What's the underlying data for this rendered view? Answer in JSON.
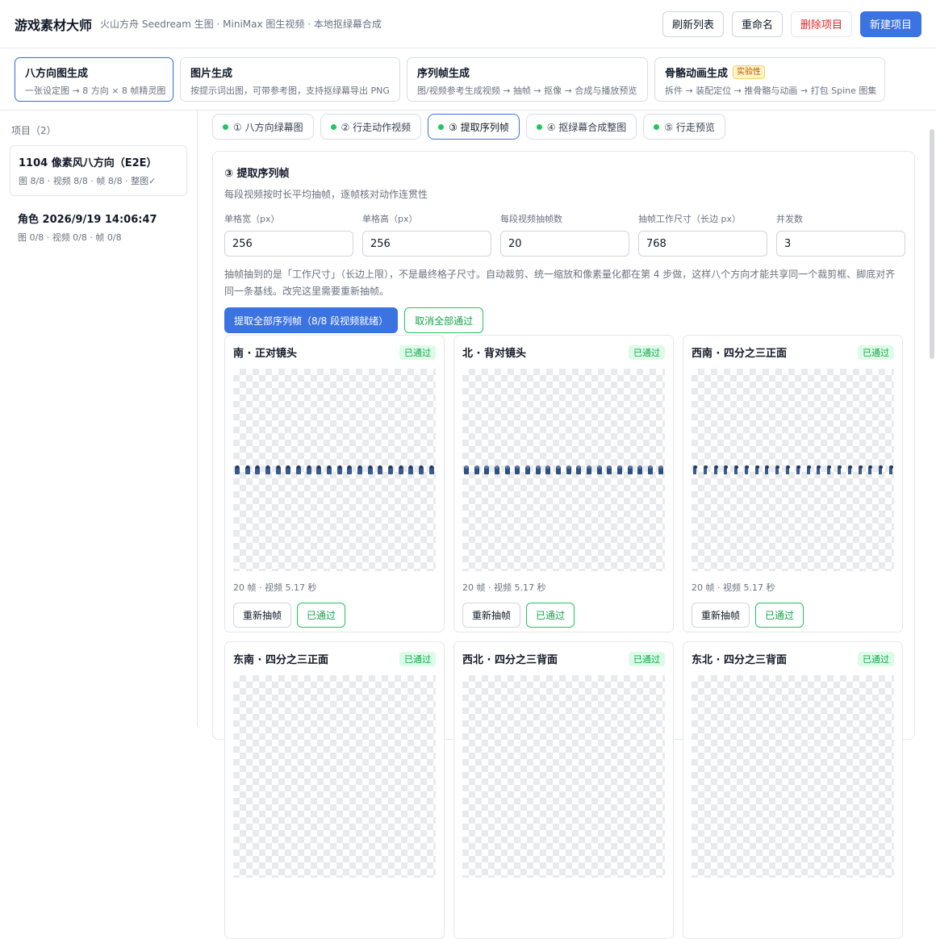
{
  "header": {
    "title": "游戏素材大师",
    "subtitle": "火山方舟 Seedream 生图 · MiniMax 图生视频 · 本地抠绿幕合成",
    "buttons": {
      "refresh": "刷新列表",
      "rename": "重命名",
      "delete": "删除项目",
      "new": "新建项目"
    }
  },
  "modes": [
    {
      "title": "八方向图生成",
      "desc": "一张设定图 → 8 方向 × 8 帧精灵图"
    },
    {
      "title": "图片生成",
      "desc": "按提示词出图，可带参考图，支持抠绿幕导出 PNG"
    },
    {
      "title": "序列帧生成",
      "desc": "图/视频参考生成视频 → 抽帧 → 抠像 → 合成与播放预览"
    },
    {
      "title": "骨骼动画生成",
      "badge": "实验性",
      "desc": "拆件 → 装配定位 → 推骨骼与动画 → 打包 Spine 图集"
    }
  ],
  "sidebar": {
    "heading": "项目（2）",
    "projects": [
      {
        "name": "1104 像素风八方向（E2E）",
        "meta": "图 8/8 · 视频 8/8 · 帧 8/8 · 整图✓"
      },
      {
        "name": "角色 2026/9/19 14:06:47",
        "meta": "图 0/8 · 视频 0/8 · 帧 0/8"
      }
    ]
  },
  "steps": [
    {
      "label": "① 八方向绿幕图"
    },
    {
      "label": "② 行走动作视频"
    },
    {
      "label": "③ 提取序列帧"
    },
    {
      "label": "④ 抠绿幕合成整图"
    },
    {
      "label": "⑤ 行走预览"
    }
  ],
  "panel": {
    "title": "③ 提取序列帧",
    "desc": "每段视频按时长平均抽帧，逐帧核对动作连贯性",
    "fields": [
      {
        "label": "单格宽（px）",
        "value": "256"
      },
      {
        "label": "单格高（px）",
        "value": "256"
      },
      {
        "label": "每段视频抽帧数",
        "value": "20"
      },
      {
        "label": "抽帧工作尺寸（长边 px）",
        "value": "768"
      },
      {
        "label": "并发数",
        "value": "3"
      }
    ],
    "note": "抽帧抽到的是「工作尺寸」（长边上限），不是最终格子尺寸。自动裁剪、统一缩放和像素量化都在第 4 步做，这样八个方向才能共享同一个裁剪框、脚底对齐同一条基线。改完这里需要重新抽帧。",
    "extract_all": "提取全部序列帧（8/8 段视频就绪）",
    "cancel_all": "取消全部通过"
  },
  "directions": [
    {
      "title": "南 · 正对镜头",
      "badge": "已通过",
      "frames": 20,
      "meta": "20 帧 · 视频 5.17 秒",
      "redo": "重新抽帧",
      "pass": "已通过",
      "pose": "front"
    },
    {
      "title": "北 · 背对镜头",
      "badge": "已通过",
      "frames": 20,
      "meta": "20 帧 · 视频 5.17 秒",
      "redo": "重新抽帧",
      "pass": "已通过",
      "pose": "back"
    },
    {
      "title": "西南 · 四分之三正面",
      "badge": "已通过",
      "frames": 20,
      "meta": "20 帧 · 视频 5.17 秒",
      "redo": "重新抽帧",
      "pass": "已通过",
      "pose": "side"
    },
    {
      "title": "东南 · 四分之三正面",
      "badge": "已通过"
    },
    {
      "title": "西北 · 四分之三背面",
      "badge": "已通过"
    },
    {
      "title": "东北 · 四分之三背面",
      "badge": "已通过"
    }
  ],
  "colors": {
    "accent": "#3b73e0",
    "success": "#16a34a",
    "danger": "#dc2626"
  }
}
